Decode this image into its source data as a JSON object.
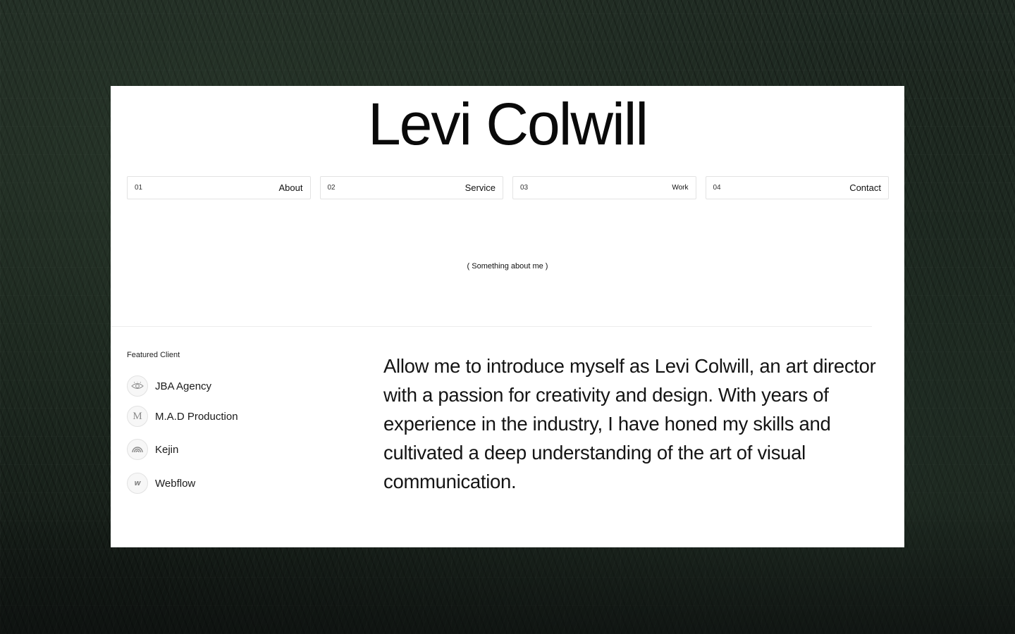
{
  "header": {
    "name": "Levi Colwill"
  },
  "nav": {
    "items": [
      {
        "num": "01",
        "label": "About"
      },
      {
        "num": "02",
        "label": "Service"
      },
      {
        "num": "03",
        "label": "Work"
      },
      {
        "num": "04",
        "label": "Contact"
      }
    ]
  },
  "about": {
    "tagline": "( Something about me )",
    "intro": "Allow me to introduce myself as Levi Colwill, an art director with a passion for creativity and design. With years of experience in the industry, I have honed my skills and cultivated a deep understanding of the art of visual communication."
  },
  "featured": {
    "title": "Featured Client",
    "clients": [
      {
        "name": "JBA Agency",
        "icon": "eye-icon"
      },
      {
        "name": "M.A.D Production",
        "icon": "m-letter-icon",
        "glyph": "M"
      },
      {
        "name": "Kejin",
        "icon": "rainbow-arc-icon"
      },
      {
        "name": "Webflow",
        "icon": "webflow-icon",
        "glyph": "w"
      }
    ]
  },
  "colors": {
    "card_background": "#ffffff",
    "page_background": "#1a231c",
    "text": "#111111"
  }
}
